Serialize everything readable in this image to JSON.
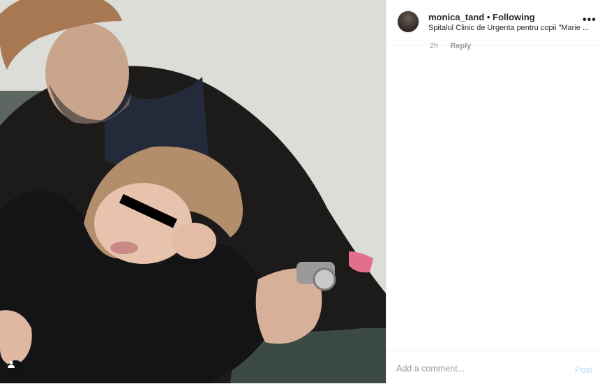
{
  "header": {
    "username": "monica_tand",
    "separator": "•",
    "follow_status": "Following",
    "location": "Spitalul Clinic de Urgenta pentru copii \"Marie ...",
    "more_icon": "more-horizontal-icon"
  },
  "comment_row": {
    "time": "2h",
    "reply_label": "Reply"
  },
  "footer": {
    "comment_placeholder": "Add a comment...",
    "post_label": "Post"
  },
  "photo": {
    "tag_icon": "user-tag-icon"
  },
  "colors": {
    "text": "#262626",
    "muted": "#999999",
    "post_disabled": "#b2dffc",
    "divider": "#efefef"
  }
}
